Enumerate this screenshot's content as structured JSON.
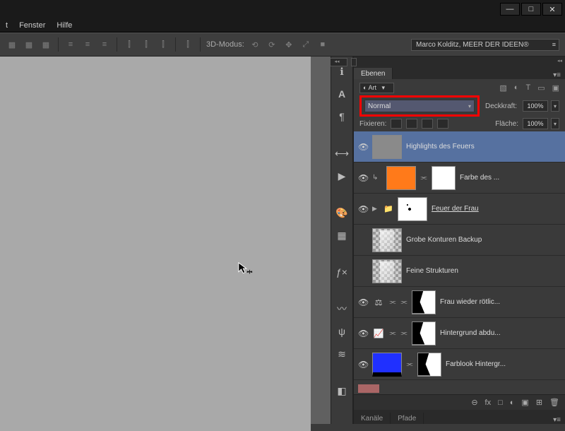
{
  "menu": {
    "i1": "t",
    "i2": "Fenster",
    "i3": "Hilfe"
  },
  "win": {
    "min": "—",
    "max": "□",
    "close": "✕"
  },
  "toolbar": {
    "mode3d": "3D-Modus:",
    "workspace": "Marco Kolditz, MEER DER IDEEN®"
  },
  "panel": {
    "tab_layers": "Ebenen",
    "tab_channels": "Kanäle",
    "tab_paths": "Pfade",
    "blend": "Normal",
    "opacity_label": "Deckkraft:",
    "opacity": "100%",
    "fill_label": "Fläche:",
    "fill": "100%",
    "lock_label": "Fixieren:"
  },
  "layers": [
    {
      "name": "Highlights des Feuers",
      "visible": true,
      "selected": true,
      "thumb": "gray"
    },
    {
      "name": "Farbe des ...",
      "visible": true,
      "thumb": "orange",
      "mask": "white",
      "clip": true
    },
    {
      "name": "Feuer der Frau",
      "visible": true,
      "thumb": "fire",
      "group": true,
      "underline": true
    },
    {
      "name": "Grobe Konturen Backup",
      "visible": false,
      "thumb": "grobe"
    },
    {
      "name": "Feine Strukturen",
      "visible": false,
      "thumb": "grobe"
    },
    {
      "name": "Frau wieder rötlic...",
      "visible": true,
      "adj": "balance",
      "mask": "shape"
    },
    {
      "name": "Hintergrund abdu...",
      "visible": true,
      "adj": "curves",
      "mask": "shape"
    },
    {
      "name": "Farblook Hintergr...",
      "visible": true,
      "thumb": "blue",
      "mask": "shape"
    }
  ],
  "footer_icons": [
    "⊖",
    "fx",
    "□",
    "◐",
    "▣",
    "⊞",
    "🗑"
  ]
}
